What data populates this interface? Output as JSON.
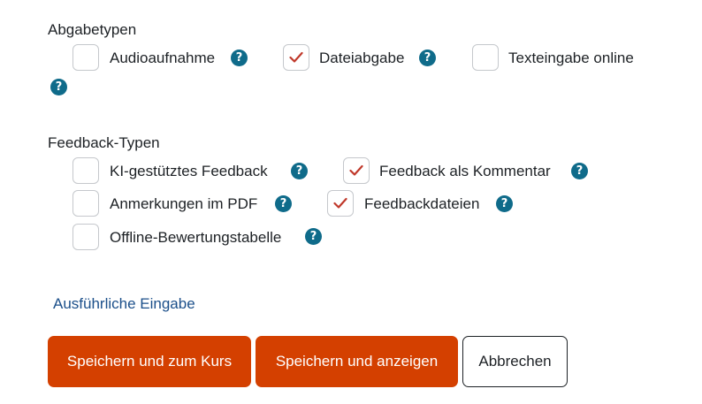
{
  "submission_types": {
    "heading": "Abgabetypen",
    "items": [
      {
        "label": "Audioaufnahme",
        "checked": false
      },
      {
        "label": "Dateiabgabe",
        "checked": true
      },
      {
        "label": "Texteingabe online",
        "checked": false
      }
    ],
    "help_icon": "question-mark-icon"
  },
  "feedback_types": {
    "heading": "Feedback-Typen",
    "items": [
      {
        "label": "KI-gestütztes Feedback",
        "checked": false
      },
      {
        "label": "Feedback als Kommentar",
        "checked": true
      },
      {
        "label": "Anmerkungen im PDF",
        "checked": false
      },
      {
        "label": "Feedbackdateien",
        "checked": true
      },
      {
        "label": "Offline-Bewertungstabelle",
        "checked": false
      }
    ]
  },
  "advanced_link": "Ausführliche Eingabe",
  "buttons": {
    "save_return": "Speichern und zum Kurs",
    "save_display": "Speichern und anzeigen",
    "cancel": "Abbrechen"
  },
  "colors": {
    "accent": "#d44000",
    "help": "#0f6b8a",
    "link": "#1b4f8a",
    "checkmark": "#c0392b"
  }
}
